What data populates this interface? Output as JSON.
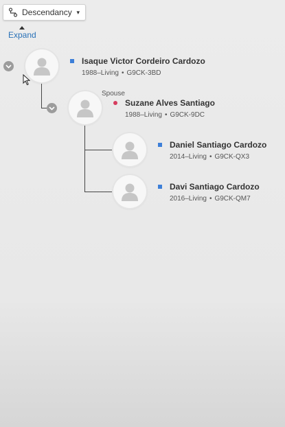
{
  "toolbar": {
    "view_label": "Descendancy",
    "caret": "▾"
  },
  "expand_label": "Expand",
  "spouse_label": "Spouse",
  "people": [
    {
      "name": "Isaque Victor Cordeiro Cardozo",
      "lifespan": "1988–Living",
      "id": "G9CK-3BD",
      "gender": "male"
    },
    {
      "name": "Suzane Alves Santiago",
      "lifespan": "1988–Living",
      "id": "G9CK-9DC",
      "gender": "female"
    },
    {
      "name": "Daniel Santiago Cardozo",
      "lifespan": "2014–Living",
      "id": "G9CK-QX3",
      "gender": "male"
    },
    {
      "name": "Davi Santiago Cardozo",
      "lifespan": "2016–Living",
      "id": "G9CK-QM7",
      "gender": "male"
    }
  ],
  "colors": {
    "male": "#3d7fd8",
    "female": "#d63c5e",
    "link": "#2a72b8"
  }
}
